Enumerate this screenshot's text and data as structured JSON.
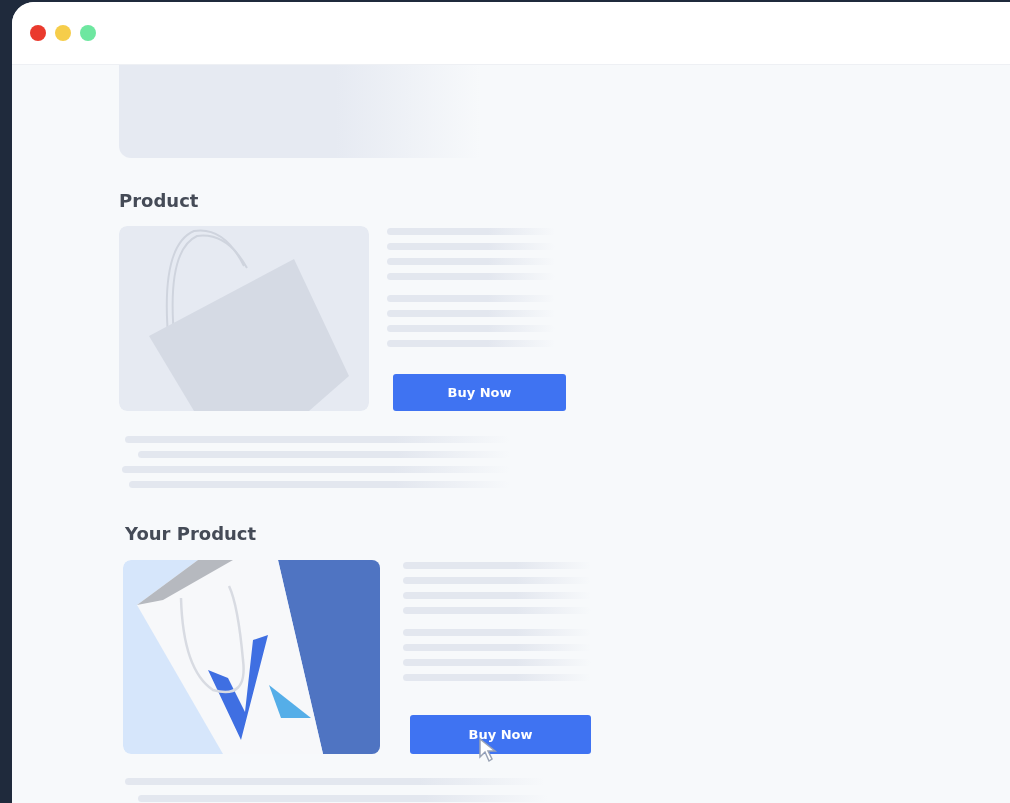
{
  "sections": [
    {
      "heading": "Product",
      "image": {
        "kind": "picture",
        "muted": true
      },
      "button": {
        "label": "Buy Now",
        "hovered": false
      }
    },
    {
      "heading": "Your Product",
      "image": {
        "kind": "picture",
        "muted": false
      },
      "button": {
        "label": "Buy Now",
        "hovered": true
      }
    }
  ]
}
